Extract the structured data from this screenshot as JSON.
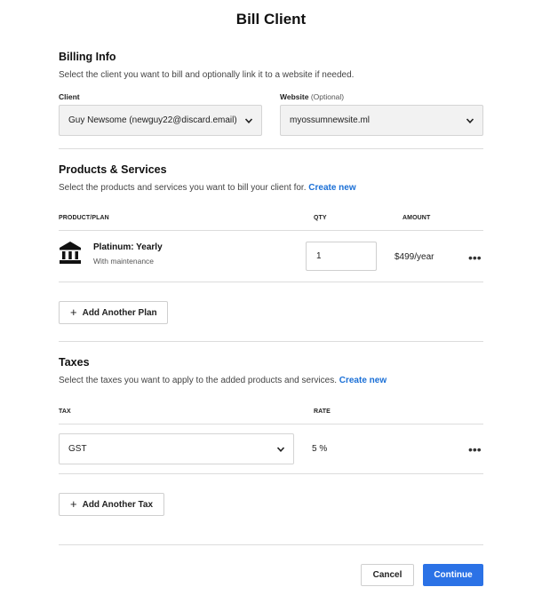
{
  "dialog": {
    "title": "Bill Client"
  },
  "billing_info": {
    "title": "Billing Info",
    "description": "Select the client you want to bill and optionally link it to a website if needed.",
    "client": {
      "label": "Client",
      "value": "Guy Newsome (newguy22@discard.email)"
    },
    "website": {
      "label": "Website",
      "optional": "(Optional)",
      "value": "myossumnewsite.ml"
    }
  },
  "products": {
    "title": "Products & Services",
    "description": "Select the products and services you want to bill your client for.",
    "create_link": "Create new",
    "columns": {
      "plan": "PRODUCT/PLAN",
      "qty": "QTY",
      "amount": "AMOUNT"
    },
    "items": [
      {
        "name": "Platinum: Yearly",
        "sub": "With maintenance",
        "qty": "1",
        "amount": "$499/year",
        "icon": "bank-building-icon"
      }
    ],
    "add_button": "Add Another Plan"
  },
  "taxes": {
    "title": "Taxes",
    "description": "Select the taxes you want to apply to the added products and services.",
    "create_link": "Create new",
    "columns": {
      "tax": "TAX",
      "rate": "RATE"
    },
    "items": [
      {
        "tax": "GST",
        "rate": "5 %"
      }
    ],
    "add_button": "Add Another Tax"
  },
  "footer": {
    "cancel": "Cancel",
    "continue": "Continue"
  },
  "colors": {
    "primary": "#2b72e6",
    "link": "#1a6fd6"
  }
}
